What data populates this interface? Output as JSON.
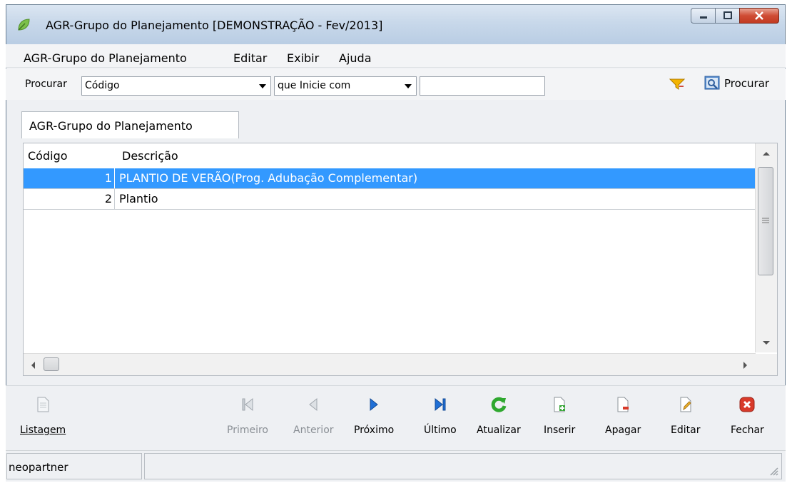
{
  "window": {
    "title": "AGR-Grupo do Planejamento [DEMONSTRAÇÃO - Fev/2013]",
    "controls": [
      "minimize-icon",
      "maximize-icon",
      "close-icon"
    ]
  },
  "menu": {
    "items": [
      "AGR-Grupo do Planejamento",
      "Editar",
      "Exibir",
      "Ajuda"
    ]
  },
  "search": {
    "label": "Procurar",
    "field_value": "Código",
    "mode_value": "que Inicie com",
    "text_value": "",
    "button_label": "Procurar"
  },
  "tab": {
    "label": "AGR-Grupo do Planejamento"
  },
  "grid": {
    "columns": [
      "Código",
      "Descrição"
    ],
    "rows": [
      {
        "code": "1",
        "description": "PLANTIO DE VERÃO(Prog. Adubação Complementar)",
        "selected": true
      },
      {
        "code": "2",
        "description": "Plantio",
        "selected": false
      }
    ]
  },
  "buttons": {
    "listagem": "Listagem",
    "primeiro": "Primeiro",
    "anterior": "Anterior",
    "proximo": "Próximo",
    "ultimo": "Último",
    "atualizar": "Atualizar",
    "inserir": "Inserir",
    "apagar": "Apagar",
    "editar": "Editar",
    "fechar": "Fechar"
  },
  "status": {
    "user": "neopartner"
  },
  "colors": {
    "selection": "#3399ff",
    "nav_blue": "#1f6fd6",
    "refresh_green": "#2fa82f",
    "close_red": "#d83a2a"
  }
}
